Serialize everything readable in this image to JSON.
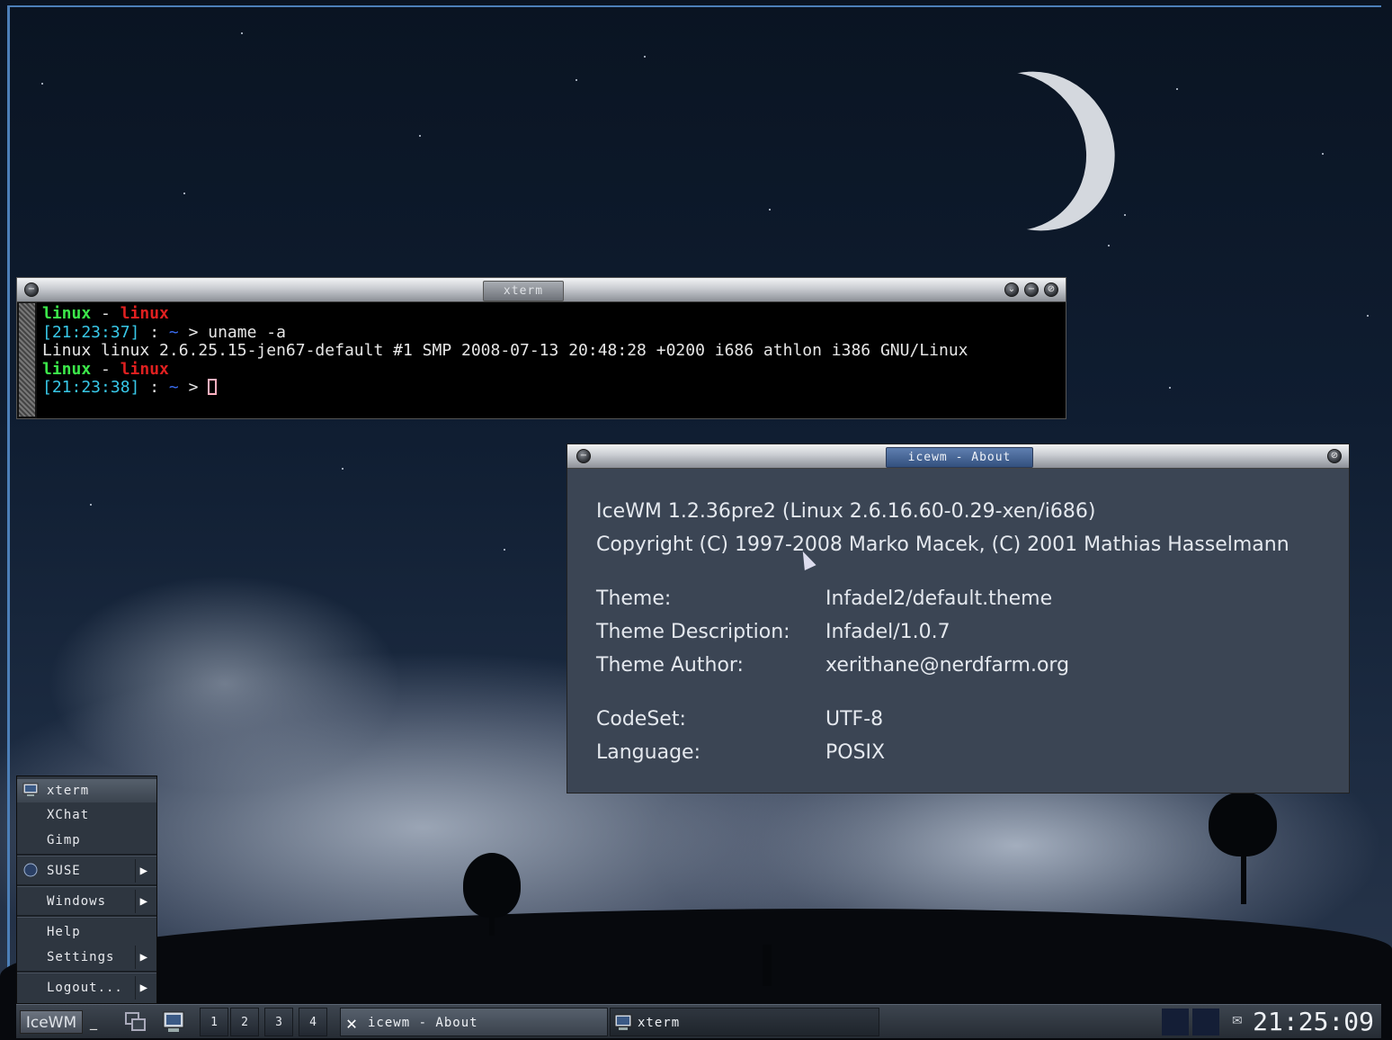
{
  "xterm": {
    "title": "xterm",
    "lines": {
      "l1_user": "linux",
      "l1_sep": " - ",
      "l1_host": "linux",
      "l2_time": "[21:23:37]",
      "l2_colon": " : ",
      "l2_tilde": "~",
      "l2_cmd": " > uname -a",
      "l3_output": "Linux linux 2.6.25.15-jen67-default #1 SMP 2008-07-13 20:48:28 +0200 i686 athlon i386 GNU/Linux",
      "l4_user": "linux",
      "l4_sep": " - ",
      "l4_host": "linux",
      "l5_time": "[21:23:38]",
      "l5_colon": " : ",
      "l5_tilde": "~",
      "l5_prompt": " > "
    }
  },
  "about": {
    "title": "icewm - About",
    "version": "IceWM 1.2.36pre2 (Linux 2.6.16.60-0.29-xen/i686)",
    "copyright": "Copyright (C) 1997-2008 Marko Macek, (C) 2001 Mathias Hasselmann",
    "rows": [
      {
        "key": "Theme:",
        "value": "Infadel2/default.theme"
      },
      {
        "key": "Theme Description:",
        "value": "Infadel/1.0.7"
      },
      {
        "key": "Theme Author:",
        "value": "xerithane@nerdfarm.org"
      },
      {
        "key": "CodeSet:",
        "value": "UTF-8"
      },
      {
        "key": "Language:",
        "value": "POSIX"
      }
    ]
  },
  "menu": {
    "items": [
      {
        "label": "xterm",
        "icon": "terminal-icon",
        "submenu": false
      },
      {
        "label": "XChat",
        "submenu": false
      },
      {
        "label": "Gimp",
        "submenu": false
      },
      {
        "label": "SUSE",
        "icon": "suse-icon",
        "submenu": true
      },
      {
        "label": "Windows",
        "submenu": true
      },
      {
        "label": "Help",
        "submenu": false
      },
      {
        "label": "Settings",
        "submenu": true
      },
      {
        "label": "Logout...",
        "submenu": true
      }
    ]
  },
  "taskbar": {
    "start_label": "IceWM",
    "workspaces": [
      "1",
      "2",
      "3",
      "4"
    ],
    "tasks": [
      {
        "label": "icewm - About",
        "icon": "x-icon",
        "active": true
      },
      {
        "label": "xterm",
        "icon": "terminal-icon",
        "active": false
      }
    ],
    "clock": "21:25:09",
    "mail_icon": "mail-icon"
  },
  "colors": {
    "prompt_user": "#3ce84a",
    "prompt_host": "#e02020",
    "prompt_time": "#38c8e8",
    "about_bg": "#3b4554",
    "frame_accent": "#4c7fb8"
  }
}
